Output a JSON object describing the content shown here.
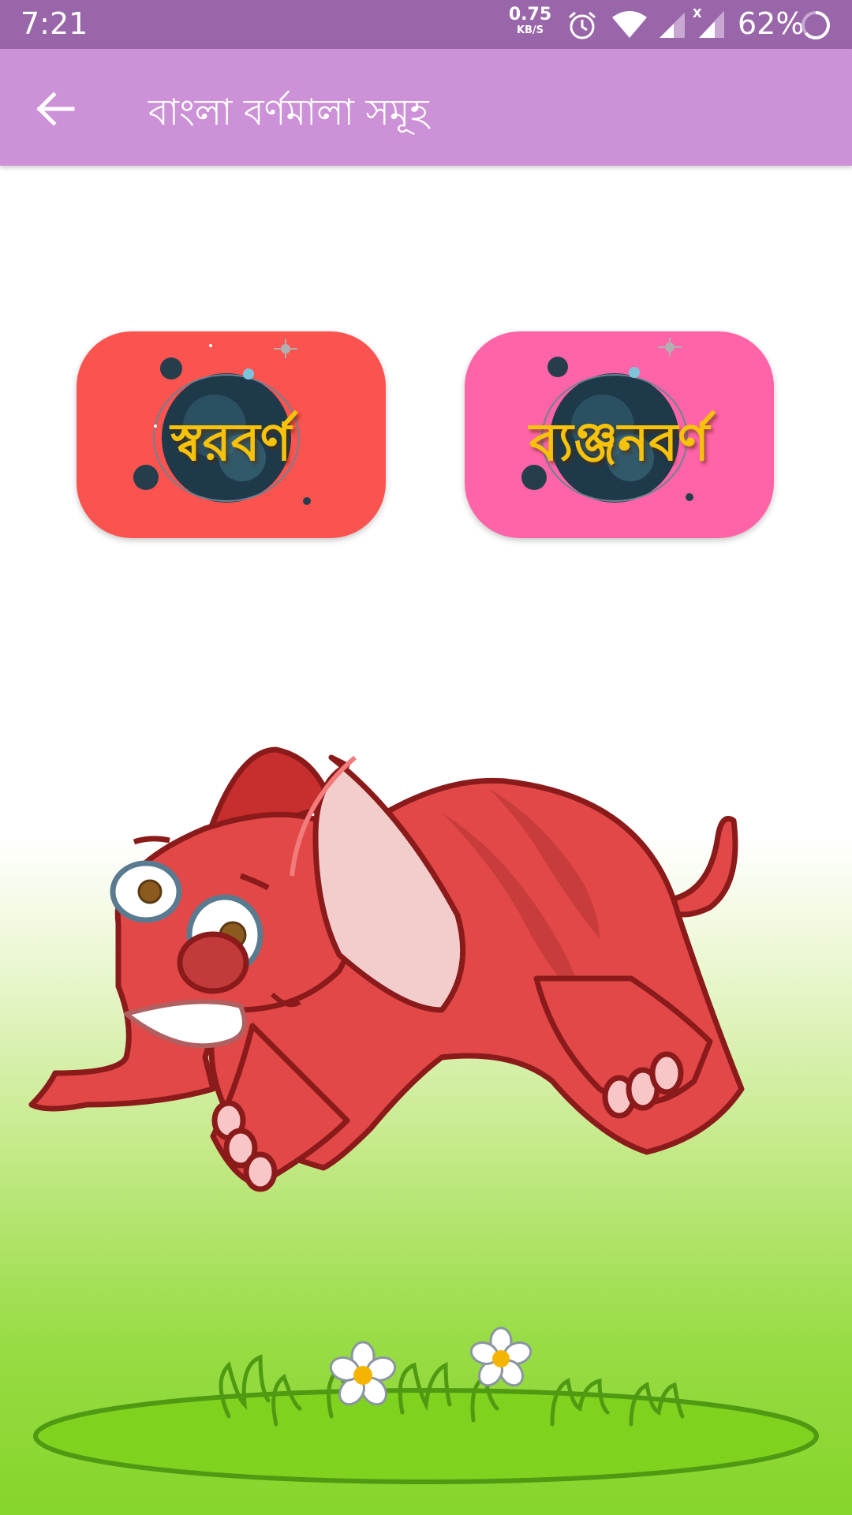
{
  "status_bar": {
    "time": "7:21",
    "net_speed_value": "0.75",
    "net_speed_unit": "KB/S",
    "battery": "62%",
    "icons": [
      "alarm-icon",
      "wifi-icon",
      "signal-icon",
      "signal-no-data-icon",
      "battery-icon"
    ]
  },
  "app_bar": {
    "back_icon": "arrow-left-icon",
    "title": "বাংলা বর্ণমালা সমূহ"
  },
  "menu": {
    "cards": [
      {
        "label": "স্বরবর্ণ",
        "color": "#fb5350"
      },
      {
        "label": "ব্যঞ্জনবর্ণ",
        "color": "#ff64a8"
      }
    ]
  },
  "illustration": {
    "subject": "elephant-illustration",
    "scenery": "grass-with-flowers"
  },
  "colors": {
    "status_bar": "#9a66aa",
    "app_bar": "#cc91d6",
    "card_label": "#f7c20a",
    "elephant_body": "#e24848",
    "grass": "#86d52a"
  }
}
